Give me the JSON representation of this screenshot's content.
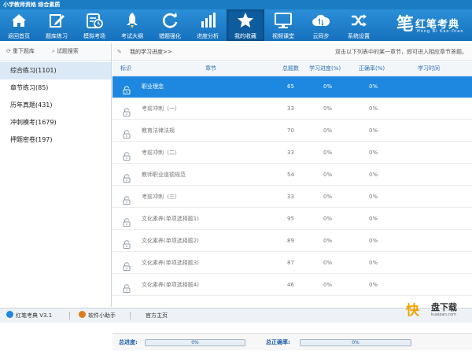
{
  "window": {
    "title": "小学教师资格 综合素质"
  },
  "toolbar": {
    "items": [
      {
        "label": "返回首页",
        "icon": "home-icon"
      },
      {
        "label": "题库练习",
        "icon": "edit-icon"
      },
      {
        "label": "模拟考场",
        "icon": "clock-icon"
      },
      {
        "label": "考试大纲",
        "icon": "rocket-icon"
      },
      {
        "label": "错题强化",
        "icon": "refresh-icon"
      },
      {
        "label": "进度分析",
        "icon": "bar-chart-icon"
      },
      {
        "label": "我的收藏",
        "icon": "star-icon"
      },
      {
        "label": "视频课堂",
        "icon": "monitor-icon"
      },
      {
        "label": "云同步",
        "icon": "cloud-sync-icon"
      },
      {
        "label": "系统设置",
        "icon": "shuffle-icon"
      }
    ],
    "active_index": 6
  },
  "logo": {
    "mark": "笔",
    "name": "红笔考典",
    "pinyin": "Hong Bi Kao Dian"
  },
  "sidebar": {
    "top_buttons": [
      {
        "label": "重下题库",
        "icon": "refresh-icon"
      },
      {
        "label": "试题搜索",
        "icon": "search-icon"
      }
    ],
    "items": [
      {
        "label": "综合练习(1101)"
      },
      {
        "label": "章节练习(85)"
      },
      {
        "label": "历年真题(431)"
      },
      {
        "label": "冲刺模考(1679)"
      },
      {
        "label": "押题密卷(197)"
      }
    ],
    "active_index": 0
  },
  "main": {
    "breadcrumb": "我的学习进度>>",
    "tip": "双击以下列表中的某一章节，即可进入相应章节答题。",
    "columns": {
      "mark": "标识",
      "chapter": "章节",
      "total": "总题数",
      "progress": "学习进度(%)",
      "accuracy": "正确率(%)",
      "time": "学习时间"
    },
    "rows": [
      {
        "chapter": "职业理念",
        "total": "65",
        "progress": "0%",
        "accuracy": "0%",
        "time": ""
      },
      {
        "chapter": "考前冲刺（一）",
        "total": "33",
        "progress": "0%",
        "accuracy": "0%",
        "time": ""
      },
      {
        "chapter": "教育法律法规",
        "total": "70",
        "progress": "0%",
        "accuracy": "0%",
        "time": ""
      },
      {
        "chapter": "考前冲刺（二）",
        "total": "33",
        "progress": "0%",
        "accuracy": "0%",
        "time": ""
      },
      {
        "chapter": "教师职业道德规范",
        "total": "54",
        "progress": "0%",
        "accuracy": "0%",
        "time": ""
      },
      {
        "chapter": "考前冲刺（三）",
        "total": "33",
        "progress": "0%",
        "accuracy": "0%",
        "time": ""
      },
      {
        "chapter": "文化素养(单项选择题1)",
        "total": "95",
        "progress": "0%",
        "accuracy": "0%",
        "time": ""
      },
      {
        "chapter": "文化素养(单项选择题2)",
        "total": "89",
        "progress": "0%",
        "accuracy": "0%",
        "time": ""
      },
      {
        "chapter": "文化素养(单项选择题3)",
        "total": "87",
        "progress": "0%",
        "accuracy": "0%",
        "time": ""
      },
      {
        "chapter": "文化素养(单项选择题4)",
        "total": "46",
        "progress": "0%",
        "accuracy": "0%",
        "time": ""
      }
    ],
    "selected_index": 0
  },
  "footer": {
    "total_progress_label": "总进度:",
    "total_progress_text": "0%",
    "total_progress_value": 0,
    "total_accuracy_label": "总正确率:",
    "total_accuracy_text": "0%",
    "total_accuracy_value": 0
  },
  "statusbar": {
    "items": [
      {
        "label": "红笔考典 V3.1",
        "icon": "info-icon",
        "color": "#1e88e0"
      },
      {
        "label": "软件小助手",
        "icon": "assistant-icon",
        "color": "#e07b1e"
      },
      {
        "label": "官方主页",
        "icon": "",
        "color": ""
      }
    ]
  },
  "brand": {
    "mark": "快",
    "name": "盘下载",
    "url": "kuaipan.com"
  },
  "colors": {
    "toolbar": "#1b7cc4",
    "selected_row": "#1e88e0",
    "accent_label": "#1e5fa8"
  }
}
